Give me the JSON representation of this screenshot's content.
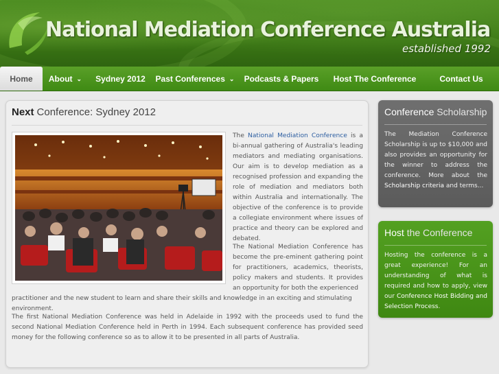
{
  "header": {
    "title": "National Mediation Conference Australia",
    "tagline": "established 1992",
    "logo_icon": "swoosh-logo-icon"
  },
  "nav": {
    "items": [
      {
        "label": "Home",
        "active": true,
        "has_dropdown": false
      },
      {
        "label": "About",
        "active": false,
        "has_dropdown": true
      },
      {
        "label": "Sydney 2012",
        "active": false,
        "has_dropdown": false
      },
      {
        "label": "Past Conferences",
        "active": false,
        "has_dropdown": true
      },
      {
        "label": "Podcasts & Papers",
        "active": false,
        "has_dropdown": false
      },
      {
        "label": "Host The Conference",
        "active": false,
        "has_dropdown": false
      },
      {
        "label": "Contact Us",
        "active": false,
        "has_dropdown": false
      }
    ]
  },
  "main": {
    "title_strong": "Next",
    "title_rest": "Conference: Sydney 2012",
    "photo_icon": "conference-hall-photo",
    "p1_lead": "The ",
    "p1_link": "National Mediation Conference",
    "p1_rest": " is a bi-annual gathering of Australia's leading mediators and mediating organisations. Our aim is to develop mediation as a recognised profession and expanding the role of mediation and mediators both within Australia and internationally. The objective of the conference is to provide a collegiate environment where issues of practice and theory can be explored and debated.",
    "p2": "The National Mediation Conference has become the pre-eminent gathering point for practitioners, academics, theorists, policy makers and students. It provides an opportunity for both the experienced",
    "p2_cont": "practitioner and the new student to learn and share their skills and knowledge in an exciting and stimulating environment.",
    "p3": "The first National Mediation Conference was held in Adelaide in 1992 with the proceeds used to fund the second National Mediation Conference held in Perth in 1994. Each subsequent conference has provided seed money for the following conference so as to allow it to be presented in all parts of Australia."
  },
  "sidebar": {
    "scholarship": {
      "title_strong": "Conference",
      "title_light": "Scholarship",
      "text": "The Mediation Conference Scholarship is up to $10,000 and also provides an opportunity for the winner to address the conference. More about the ",
      "link": "Scholarship criteria",
      "text_end": " and terms..."
    },
    "host": {
      "title_strong": "Host",
      "title_light": "the Conference",
      "text": "Hosting the conference is a great experience! For an understanding of what is required and how to apply, view our ",
      "link": "Conference Host Bidding and Selection Process",
      "text_end": "."
    }
  },
  "colors": {
    "brand_green": "#3f8a14",
    "link_blue": "#2b5da0",
    "sidebar_grey": "#666666"
  }
}
